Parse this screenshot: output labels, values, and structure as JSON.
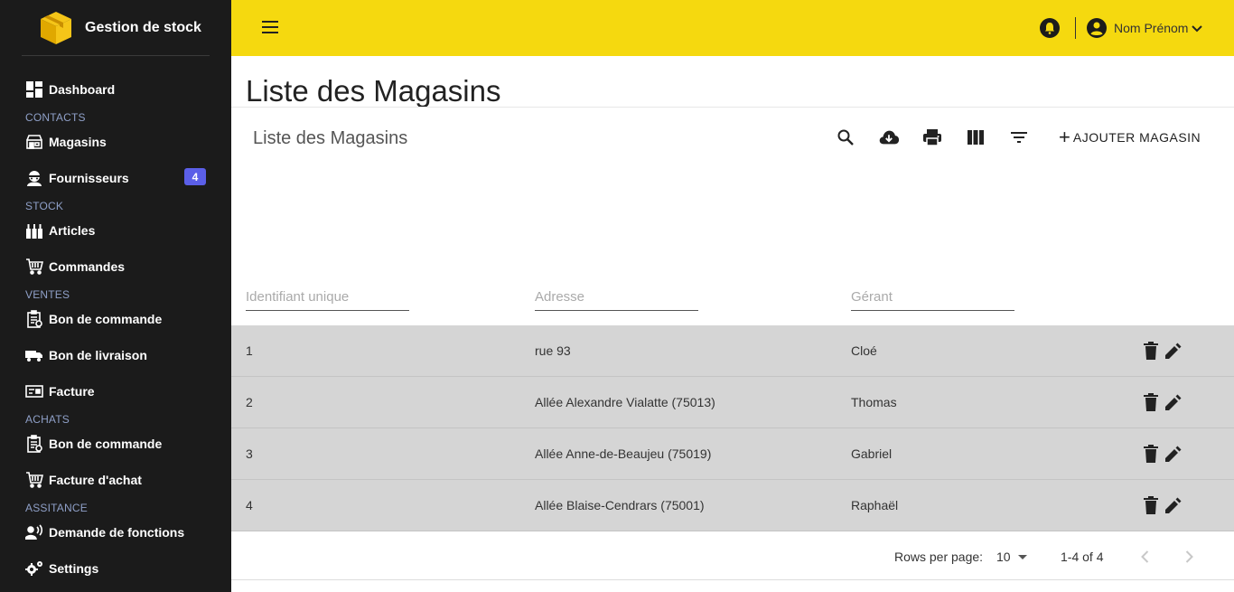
{
  "app": {
    "title": "Gestion de stock",
    "accent_color": "#f5d90f",
    "sidebar_bg": "#1b1b1b",
    "badge_color": "#5b5fe8"
  },
  "sidebar": {
    "sections": {
      "contacts": "CONTACTS",
      "stock": "STOCK",
      "ventes": "VENTES",
      "achats": "ACHATS",
      "assistance": "ASSITANCE"
    },
    "items": {
      "dashboard": {
        "label": "Dashboard",
        "icon": "dashboard-icon"
      },
      "magasins": {
        "label": "Magasins",
        "icon": "store-icon"
      },
      "fournisseurs": {
        "label": "Fournisseurs",
        "icon": "supplier-icon",
        "badge": "4"
      },
      "articles": {
        "label": "Articles",
        "icon": "bottles-icon"
      },
      "commandes": {
        "label": "Commandes",
        "icon": "cart-icon"
      },
      "bon_commande_ventes": {
        "label": "Bon de commande",
        "icon": "clipboard-icon"
      },
      "bon_livraison": {
        "label": "Bon de livraison",
        "icon": "truck-icon"
      },
      "facture": {
        "label": "Facture",
        "icon": "card-icon"
      },
      "bon_commande_achats": {
        "label": "Bon de commande",
        "icon": "clipboard-icon"
      },
      "facture_achat": {
        "label": "Facture d'achat",
        "icon": "cart-icon"
      },
      "demande_fonctions": {
        "label": "Demande de fonctions",
        "icon": "voice-icon"
      },
      "settings": {
        "label": "Settings",
        "icon": "gears-icon"
      }
    }
  },
  "topbar": {
    "user_name": "Nom Prénom",
    "notification_icon": "bell-icon"
  },
  "main": {
    "page_title": "Liste des Magasins",
    "card_title": "Liste des Magasins",
    "toolbar": {
      "add_label": "AJOUTER MAGASIN",
      "icons": [
        "search-icon",
        "download-icon",
        "print-icon",
        "columns-icon",
        "filter-icon"
      ]
    },
    "filters": {
      "id_placeholder": "Identifiant unique",
      "address_placeholder": "Adresse",
      "manager_placeholder": "Gérant"
    },
    "rows": [
      {
        "id": "1",
        "address": "rue 93",
        "manager": "Cloé"
      },
      {
        "id": "2",
        "address": "Allée Alexandre Vialatte (75013)",
        "manager": "Thomas"
      },
      {
        "id": "3",
        "address": "Allée Anne-de-Beaujeu (75019)",
        "manager": "Gabriel"
      },
      {
        "id": "4",
        "address": "Allée Blaise-Cendrars (75001)",
        "manager": "Raphaël"
      }
    ],
    "pagination": {
      "rows_per_page_label": "Rows per page:",
      "rows_per_page": "10",
      "range": "1-4 of 4"
    }
  }
}
